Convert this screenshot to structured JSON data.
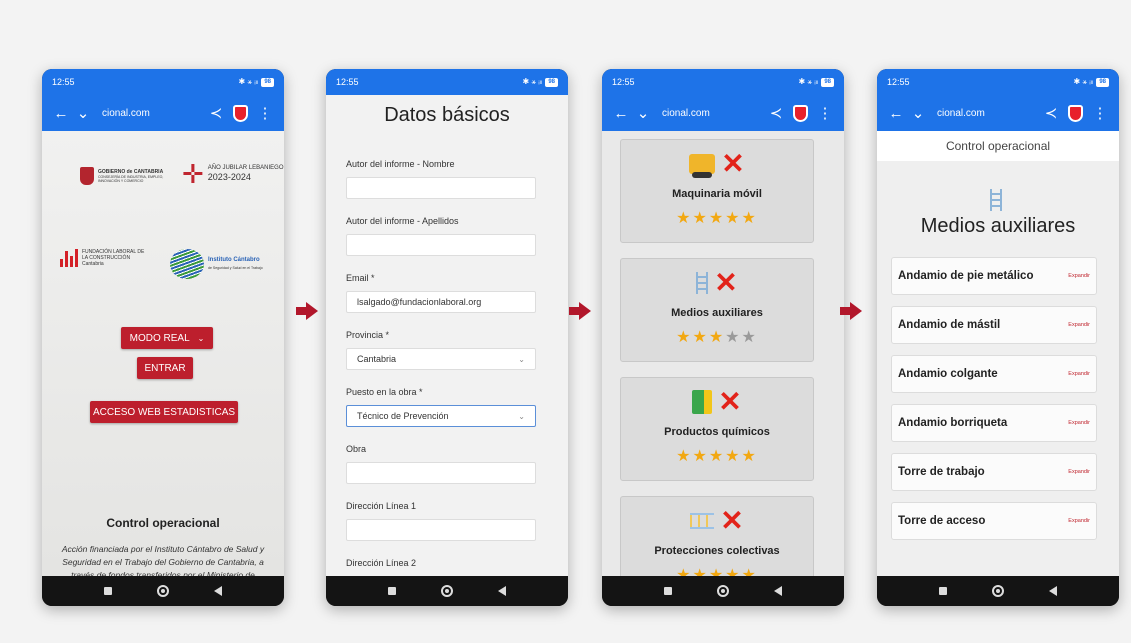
{
  "status": {
    "time": "12:55",
    "time2": "12:55",
    "time3": "12:55",
    "icons": "✱ ⚹ ᵢₗₗ",
    "battery": "98"
  },
  "browser": {
    "url": "cional.com"
  },
  "screen1": {
    "logo_gobierno": "GOBIERNO de CANTABRIA",
    "logo_gobierno_sub": "CONSEJERÍA DE INDUSTRIA, EMPLEO, INNOVACIÓN Y COMERCIO",
    "logo_jubilar": "AÑO JUBILAR LEBANIEGO",
    "logo_jubilar_year": "2023-2024",
    "logo_fundacion": "FUNDACIÓN LABORAL DE LA CONSTRUCCIÓN",
    "logo_fundacion_sub": "Cantabria",
    "logo_instituto": "Instituto Cántabro",
    "logo_instituto_sub": "de Seguridad y Salud en el Trabajo",
    "mode_select": "MODO REAL",
    "enter_button": "ENTRAR",
    "stats_button": "ACCESO WEB ESTADISTICAS",
    "heading": "Control operacional",
    "description": "Acción financiada por el Instituto Cántabro de Salud y Seguridad en el Trabajo del Gobierno de Cantabria, a través de fondos transferidos por el Ministerio de Trabajo y Economía Social."
  },
  "screen2": {
    "title": "Datos básicos",
    "fields": [
      {
        "label": "Autor del informe - Nombre",
        "value": ""
      },
      {
        "label": "Autor del informe - Apellidos",
        "value": ""
      },
      {
        "label": "Email *",
        "value": "lsalgado@fundacionlaboral.org"
      },
      {
        "label": "Provincia *",
        "value": "Cantabria"
      },
      {
        "label": "Puesto en la obra *",
        "value": "Técnico de Prevención"
      },
      {
        "label": "Obra",
        "value": ""
      },
      {
        "label": "Dirección Línea 1",
        "value": ""
      },
      {
        "label": "Dirección Línea 2",
        "value": ""
      }
    ]
  },
  "screen3": {
    "cards": [
      {
        "title": "Maquinaria móvil",
        "rating": 5,
        "icon": "truck-icon"
      },
      {
        "title": "Medios auxiliares",
        "rating": 3,
        "icon": "ladder-icon"
      },
      {
        "title": "Productos químicos",
        "rating": 5,
        "icon": "chemical-icon"
      },
      {
        "title": "Protecciones colectivas",
        "rating": 5,
        "icon": "railing-icon"
      }
    ]
  },
  "screen4": {
    "header": "Control operacional",
    "title": "Medios auxiliares",
    "expand_label": "Expandir",
    "items": [
      "Andamio de pie metálico",
      "Andamio de mástil",
      "Andamio colgante",
      "Andamio borriqueta",
      "Torre de trabajo",
      "Torre de acceso"
    ]
  },
  "colors": {
    "browser_blue": "#1e73e8",
    "brand_red": "#bd1f2d",
    "star": "#f2a812",
    "x_red": "#e2231a"
  }
}
